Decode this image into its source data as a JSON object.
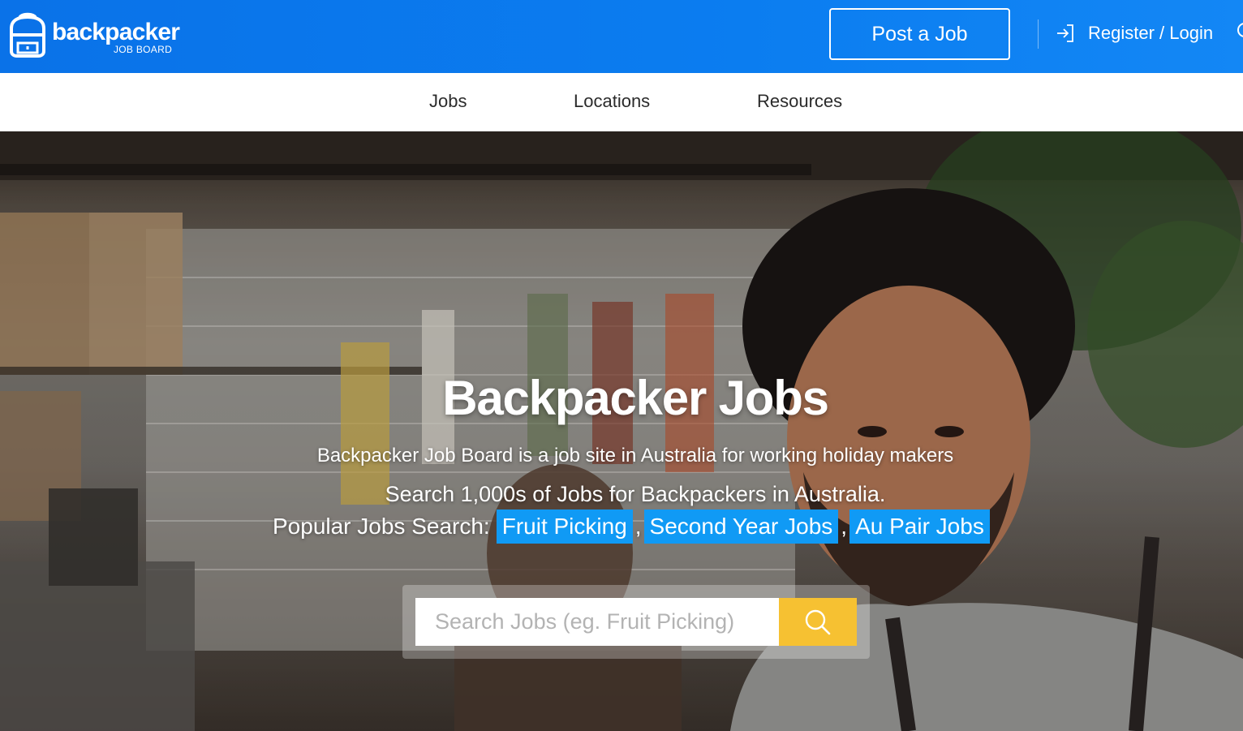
{
  "header": {
    "logo": {
      "word": "backpacker",
      "sub": "JOB BOARD",
      "icon": "backpack-icon"
    },
    "post_job_label": "Post a Job",
    "login_label": "Register / Login",
    "login_icon": "login-arrow-icon",
    "search_icon": "search-icon",
    "colors": {
      "bar": "#0b7df0",
      "text": "#ffffff"
    }
  },
  "nav": {
    "items": [
      {
        "label": "Jobs"
      },
      {
        "label": "Locations"
      },
      {
        "label": "Resources"
      }
    ]
  },
  "hero": {
    "title": "Backpacker Jobs",
    "description": "Backpacker Job Board is a job site in Australia for working holiday makers",
    "count_line": "Search 1,000s of Jobs for Backpackers in Australia.",
    "popular": {
      "label": "Popular Jobs Search:",
      "tags": [
        "Fruit Picking",
        "Second Year Jobs",
        "Au Pair Jobs"
      ],
      "separator": ","
    },
    "search": {
      "placeholder": "Search Jobs (eg. Fruit Picking)",
      "value": "",
      "button_icon": "search-icon"
    },
    "colors": {
      "tag_bg": "#109af5",
      "search_button": "#f6c132"
    }
  }
}
